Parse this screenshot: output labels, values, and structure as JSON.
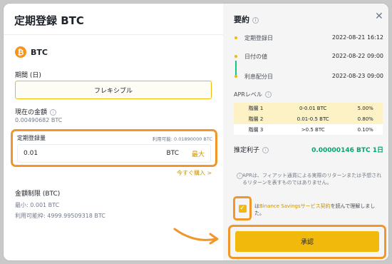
{
  "dialog": {
    "title": "定期登録 BTC",
    "coin": "BTC",
    "period_label": "期間 (日)",
    "period_option": "フレキシブル",
    "current_amount_label": "現在の金額",
    "current_amount_value": "0.00490682 BTC",
    "subscribe_amount_label": "定期登録量",
    "available_label": "利用可能: 0.01890000 BTC",
    "amount_value": "0.01",
    "amount_unit": "BTC",
    "max_label": "最大",
    "buy_link": "今すぐ購入 >",
    "limit_label": "金額制限 (BTC)",
    "min_text": "最小: 0.001 BTC",
    "available_quota_text": "利用可能枠: 4999.99509318 BTC"
  },
  "summary": {
    "title": "要約",
    "close_icon": "close-icon",
    "timeline": [
      {
        "label": "定期登録日",
        "value": "2022-08-21 16:12"
      },
      {
        "label": "日付の値",
        "value": "2022-08-22 09:00"
      },
      {
        "label": "利息配分日",
        "value": "2022-08-23 09:00"
      }
    ],
    "apr_label": "APRレベル",
    "apr_tiers": [
      {
        "tier": "階層 1",
        "range": "0-0.01 BTC",
        "rate": "5.00%"
      },
      {
        "tier": "階層 2",
        "range": "0.01-0.5 BTC",
        "rate": "0.80%"
      },
      {
        "tier": "階層 3",
        "range": ">0.5 BTC",
        "rate": "0.10%"
      }
    ],
    "estimated_interest_label": "推定利子",
    "estimated_interest_value": "0.00000146 BTC 1日",
    "notice": "APRは、フィアット通貨による実際のリターンまたは予想されるリターンを表すものではありません。",
    "agree_prefix": "は",
    "agree_link": "Binance Savingsサービス契約",
    "agree_suffix": "を読んで理解しました。",
    "confirm_label": "承認"
  },
  "colors": {
    "accent": "#f0b90b",
    "highlight": "#f0962b",
    "positive": "#03a66d"
  }
}
